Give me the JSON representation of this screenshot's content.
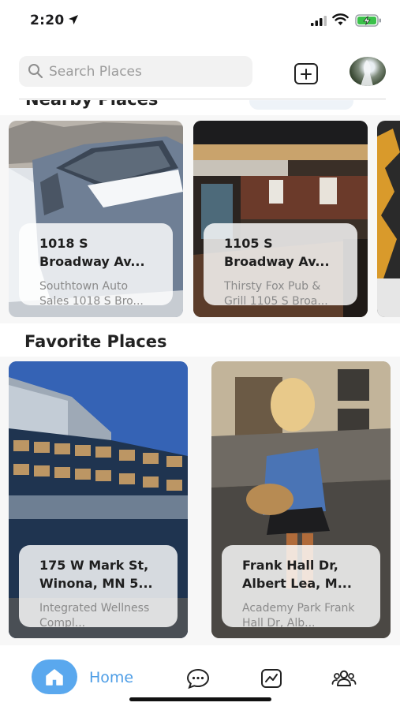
{
  "status_bar": {
    "time": "2:20"
  },
  "header": {
    "search": {
      "placeholder": "Search Places",
      "value": ""
    }
  },
  "nearby_section": {
    "title": "Nearby Places",
    "cards": [
      {
        "address": "1018 S Broadway Av...",
        "description": "Southtown Auto Sales 1018 S Bro..."
      },
      {
        "address": "1105 S Broadway Av...",
        "description": "Thirsty Fox Pub & Grill 1105 S Broa..."
      }
    ]
  },
  "favorites_section": {
    "title": "Favorite Places",
    "cards": [
      {
        "address": "175 W Mark St, Winona, MN 5...",
        "description": "Integrated Wellness Compl..."
      },
      {
        "address": "Frank Hall Dr, Albert Lea, M...",
        "description": "Academy Park Frank Hall Dr, Alb..."
      }
    ]
  },
  "bottom_nav": {
    "items": [
      {
        "label": "Home",
        "icon": "home-icon",
        "active": true
      },
      {
        "icon": "chat-icon"
      },
      {
        "icon": "activity-chart-icon"
      },
      {
        "icon": "group-icon"
      }
    ]
  },
  "colors": {
    "accent": "#5aa8ee",
    "accent_text": "#4d9de6"
  }
}
